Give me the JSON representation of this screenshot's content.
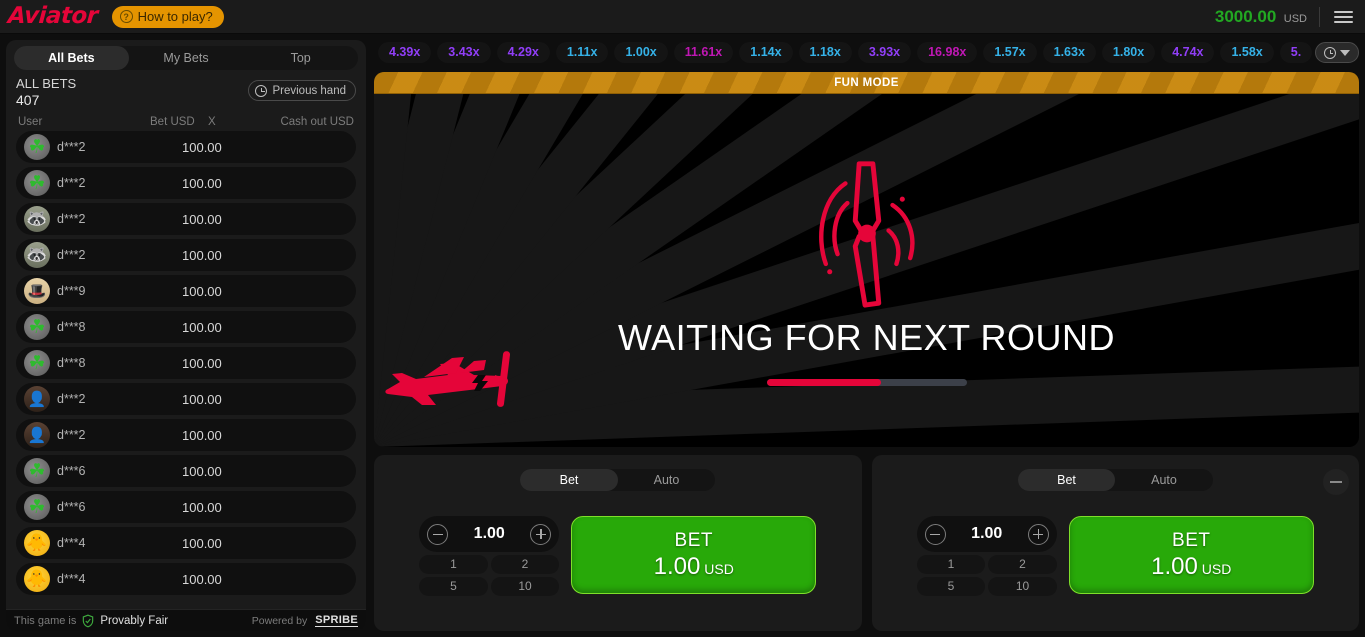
{
  "topbar": {
    "logo": "Aviator",
    "how_to_play": "How to play?",
    "help_icon": "question-mark-circle-icon",
    "balance": "3000.00",
    "currency": "USD",
    "menu_icon": "hamburger-menu-icon",
    "balance_color": "#22a822",
    "brand_color": "#e50539"
  },
  "sidebar": {
    "tabs": [
      {
        "label": "All Bets",
        "active": true
      },
      {
        "label": "My Bets",
        "active": false
      },
      {
        "label": "Top",
        "active": false
      }
    ],
    "section_title": "ALL BETS",
    "bets_count": "407",
    "previous_hand": "Previous hand",
    "previous_hand_icon": "history-clock-icon",
    "columns": [
      "User",
      "Bet USD",
      "X",
      "Cash out USD"
    ],
    "rows": [
      {
        "user": "d***2",
        "bet": "100.00",
        "x": "",
        "cashout": "",
        "avatar": "clover-avatar"
      },
      {
        "user": "d***2",
        "bet": "100.00",
        "x": "",
        "cashout": "",
        "avatar": "clover-avatar"
      },
      {
        "user": "d***2",
        "bet": "100.00",
        "x": "",
        "cashout": "",
        "avatar": "raccoon-avatar"
      },
      {
        "user": "d***2",
        "bet": "100.00",
        "x": "",
        "cashout": "",
        "avatar": "raccoon-avatar"
      },
      {
        "user": "d***9",
        "bet": "100.00",
        "x": "",
        "cashout": "",
        "avatar": "tophat-avatar"
      },
      {
        "user": "d***8",
        "bet": "100.00",
        "x": "",
        "cashout": "",
        "avatar": "clover-avatar"
      },
      {
        "user": "d***8",
        "bet": "100.00",
        "x": "",
        "cashout": "",
        "avatar": "clover-avatar"
      },
      {
        "user": "d***2",
        "bet": "100.00",
        "x": "",
        "cashout": "",
        "avatar": "person-avatar"
      },
      {
        "user": "d***2",
        "bet": "100.00",
        "x": "",
        "cashout": "",
        "avatar": "person-avatar"
      },
      {
        "user": "d***6",
        "bet": "100.00",
        "x": "",
        "cashout": "",
        "avatar": "clover-avatar"
      },
      {
        "user": "d***6",
        "bet": "100.00",
        "x": "",
        "cashout": "",
        "avatar": "clover-avatar"
      },
      {
        "user": "d***4",
        "bet": "100.00",
        "x": "",
        "cashout": "",
        "avatar": "duck-avatar"
      },
      {
        "user": "d***4",
        "bet": "100.00",
        "x": "",
        "cashout": "",
        "avatar": "duck-avatar"
      }
    ],
    "footer": {
      "prefix": "This game is",
      "fair_label": "Provably Fair",
      "fair_icon": "shield-check-icon",
      "powered_by": "Powered by",
      "provider": "SPRIBE"
    }
  },
  "history": {
    "multipliers": [
      {
        "value": "4.39x",
        "tone": "purple"
      },
      {
        "value": "3.43x",
        "tone": "purple"
      },
      {
        "value": "4.29x",
        "tone": "purple"
      },
      {
        "value": "1.11x",
        "tone": "blue"
      },
      {
        "value": "1.00x",
        "tone": "blue"
      },
      {
        "value": "11.61x",
        "tone": "pink"
      },
      {
        "value": "1.14x",
        "tone": "blue"
      },
      {
        "value": "1.18x",
        "tone": "blue"
      },
      {
        "value": "3.93x",
        "tone": "purple"
      },
      {
        "value": "16.98x",
        "tone": "pink"
      },
      {
        "value": "1.57x",
        "tone": "blue"
      },
      {
        "value": "1.63x",
        "tone": "blue"
      },
      {
        "value": "1.80x",
        "tone": "blue"
      },
      {
        "value": "4.74x",
        "tone": "purple"
      },
      {
        "value": "1.58x",
        "tone": "blue"
      },
      {
        "value": "5.",
        "tone": "purple"
      }
    ],
    "toggle_icon": "history-clock-icon",
    "toggle_chevron": "chevron-down-icon",
    "colors": {
      "blue": "#35b2e8",
      "purple": "#913ef8",
      "pink": "#c017b4"
    }
  },
  "game": {
    "fun_mode_banner": "FUN MODE",
    "fun_mode_color": "#c8870d",
    "status_text": "WAITING FOR NEXT ROUND",
    "progress_percent": 57,
    "progress_color": "#e50539",
    "propeller_icon": "propeller-icon",
    "plane_icon": "airplane-icon"
  },
  "bet_panels": [
    {
      "modes": [
        {
          "label": "Bet",
          "active": true
        },
        {
          "label": "Auto",
          "active": false
        }
      ],
      "stake": "1.00",
      "decrement_icon": "minus-circle-icon",
      "increment_icon": "plus-circle-icon",
      "quick_amounts": [
        "1",
        "2",
        "5",
        "10"
      ],
      "action_label": "BET",
      "action_amount": "1.00",
      "action_currency": "USD",
      "action_color": "#28a909",
      "has_remove": false
    },
    {
      "modes": [
        {
          "label": "Bet",
          "active": true
        },
        {
          "label": "Auto",
          "active": false
        }
      ],
      "stake": "1.00",
      "decrement_icon": "minus-circle-icon",
      "increment_icon": "plus-circle-icon",
      "quick_amounts": [
        "1",
        "2",
        "5",
        "10"
      ],
      "action_label": "BET",
      "action_amount": "1.00",
      "action_currency": "USD",
      "action_color": "#28a909",
      "has_remove": true,
      "remove_icon": "minus-icon"
    }
  ]
}
